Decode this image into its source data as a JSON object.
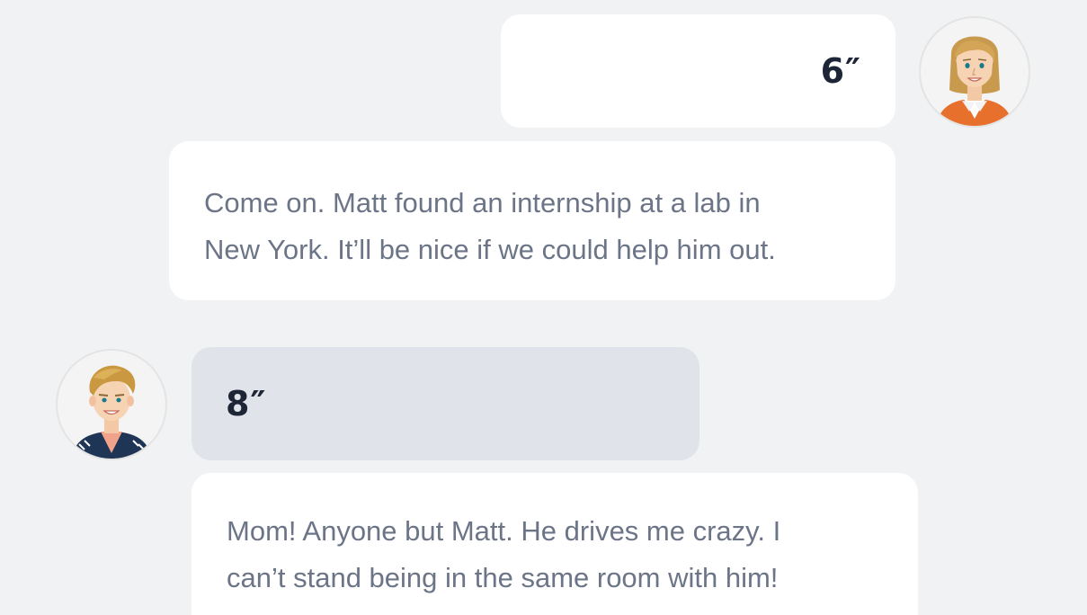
{
  "messages": [
    {
      "speaker": "mom",
      "side": "right",
      "audio_duration": "6″",
      "text": "Come on. Matt found an internship at a lab in New York. It’ll be nice if we could help him out.",
      "text_lines": [
        "Come on. Matt found an internship at a lab in",
        "New York. It’ll be nice if we could help him out."
      ]
    },
    {
      "speaker": "son",
      "side": "left",
      "audio_duration": "8″",
      "text": "Mom! Anyone but Matt. He drives me crazy. I can’t stand being in the same room with him!",
      "text_lines": [
        "Mom! Anyone but Matt. He drives me crazy. I",
        "can’t stand being in the same room with him!"
      ]
    }
  ],
  "icons": {
    "mom_avatar": "woman-avatar-icon",
    "son_avatar": "boy-avatar-icon"
  },
  "colors": {
    "background": "#f1f2f4",
    "bubble": "#ffffff",
    "bubble_active": "#e0e3e9",
    "duration_text": "#1d2537",
    "message_text": "#6c7588",
    "mom_jacket": "#e8702d",
    "son_jacket": "#1f3556"
  }
}
